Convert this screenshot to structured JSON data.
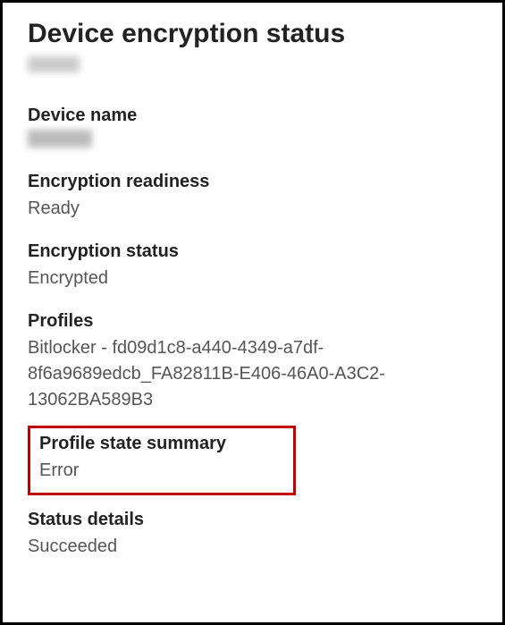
{
  "page": {
    "title": "Device encryption status"
  },
  "fields": {
    "device_name": {
      "label": "Device name"
    },
    "encryption_readiness": {
      "label": "Encryption readiness",
      "value": "Ready"
    },
    "encryption_status": {
      "label": "Encryption status",
      "value": "Encrypted"
    },
    "profiles": {
      "label": "Profiles",
      "value": "Bitlocker - fd09d1c8-a440-4349-a7df-8f6a9689edcb_FA82811B-E406-46A0-A3C2-13062BA589B3"
    },
    "profile_state_summary": {
      "label": "Profile state summary",
      "value": "Error"
    },
    "status_details": {
      "label": "Status details",
      "value": "Succeeded"
    }
  }
}
